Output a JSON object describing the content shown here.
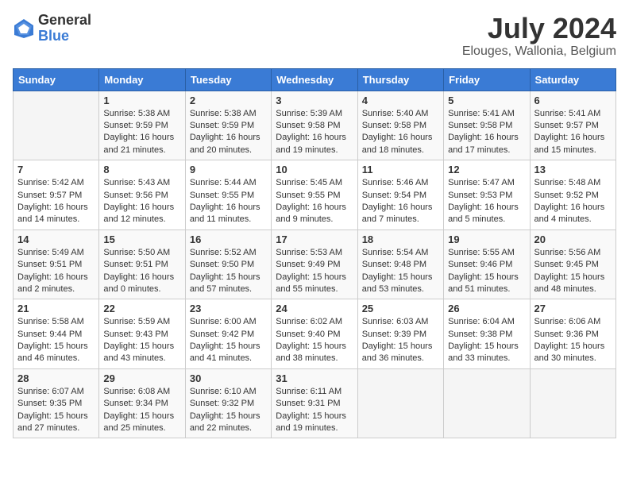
{
  "header": {
    "logo_general": "General",
    "logo_blue": "Blue",
    "main_title": "July 2024",
    "subtitle": "Elouges, Wallonia, Belgium"
  },
  "calendar": {
    "days_of_week": [
      "Sunday",
      "Monday",
      "Tuesday",
      "Wednesday",
      "Thursday",
      "Friday",
      "Saturday"
    ],
    "weeks": [
      [
        {
          "day": "",
          "sunrise": "",
          "sunset": "",
          "daylight": ""
        },
        {
          "day": "1",
          "sunrise": "Sunrise: 5:38 AM",
          "sunset": "Sunset: 9:59 PM",
          "daylight": "Daylight: 16 hours and 21 minutes."
        },
        {
          "day": "2",
          "sunrise": "Sunrise: 5:38 AM",
          "sunset": "Sunset: 9:59 PM",
          "daylight": "Daylight: 16 hours and 20 minutes."
        },
        {
          "day": "3",
          "sunrise": "Sunrise: 5:39 AM",
          "sunset": "Sunset: 9:58 PM",
          "daylight": "Daylight: 16 hours and 19 minutes."
        },
        {
          "day": "4",
          "sunrise": "Sunrise: 5:40 AM",
          "sunset": "Sunset: 9:58 PM",
          "daylight": "Daylight: 16 hours and 18 minutes."
        },
        {
          "day": "5",
          "sunrise": "Sunrise: 5:41 AM",
          "sunset": "Sunset: 9:58 PM",
          "daylight": "Daylight: 16 hours and 17 minutes."
        },
        {
          "day": "6",
          "sunrise": "Sunrise: 5:41 AM",
          "sunset": "Sunset: 9:57 PM",
          "daylight": "Daylight: 16 hours and 15 minutes."
        }
      ],
      [
        {
          "day": "7",
          "sunrise": "Sunrise: 5:42 AM",
          "sunset": "Sunset: 9:57 PM",
          "daylight": "Daylight: 16 hours and 14 minutes."
        },
        {
          "day": "8",
          "sunrise": "Sunrise: 5:43 AM",
          "sunset": "Sunset: 9:56 PM",
          "daylight": "Daylight: 16 hours and 12 minutes."
        },
        {
          "day": "9",
          "sunrise": "Sunrise: 5:44 AM",
          "sunset": "Sunset: 9:55 PM",
          "daylight": "Daylight: 16 hours and 11 minutes."
        },
        {
          "day": "10",
          "sunrise": "Sunrise: 5:45 AM",
          "sunset": "Sunset: 9:55 PM",
          "daylight": "Daylight: 16 hours and 9 minutes."
        },
        {
          "day": "11",
          "sunrise": "Sunrise: 5:46 AM",
          "sunset": "Sunset: 9:54 PM",
          "daylight": "Daylight: 16 hours and 7 minutes."
        },
        {
          "day": "12",
          "sunrise": "Sunrise: 5:47 AM",
          "sunset": "Sunset: 9:53 PM",
          "daylight": "Daylight: 16 hours and 5 minutes."
        },
        {
          "day": "13",
          "sunrise": "Sunrise: 5:48 AM",
          "sunset": "Sunset: 9:52 PM",
          "daylight": "Daylight: 16 hours and 4 minutes."
        }
      ],
      [
        {
          "day": "14",
          "sunrise": "Sunrise: 5:49 AM",
          "sunset": "Sunset: 9:51 PM",
          "daylight": "Daylight: 16 hours and 2 minutes."
        },
        {
          "day": "15",
          "sunrise": "Sunrise: 5:50 AM",
          "sunset": "Sunset: 9:51 PM",
          "daylight": "Daylight: 16 hours and 0 minutes."
        },
        {
          "day": "16",
          "sunrise": "Sunrise: 5:52 AM",
          "sunset": "Sunset: 9:50 PM",
          "daylight": "Daylight: 15 hours and 57 minutes."
        },
        {
          "day": "17",
          "sunrise": "Sunrise: 5:53 AM",
          "sunset": "Sunset: 9:49 PM",
          "daylight": "Daylight: 15 hours and 55 minutes."
        },
        {
          "day": "18",
          "sunrise": "Sunrise: 5:54 AM",
          "sunset": "Sunset: 9:48 PM",
          "daylight": "Daylight: 15 hours and 53 minutes."
        },
        {
          "day": "19",
          "sunrise": "Sunrise: 5:55 AM",
          "sunset": "Sunset: 9:46 PM",
          "daylight": "Daylight: 15 hours and 51 minutes."
        },
        {
          "day": "20",
          "sunrise": "Sunrise: 5:56 AM",
          "sunset": "Sunset: 9:45 PM",
          "daylight": "Daylight: 15 hours and 48 minutes."
        }
      ],
      [
        {
          "day": "21",
          "sunrise": "Sunrise: 5:58 AM",
          "sunset": "Sunset: 9:44 PM",
          "daylight": "Daylight: 15 hours and 46 minutes."
        },
        {
          "day": "22",
          "sunrise": "Sunrise: 5:59 AM",
          "sunset": "Sunset: 9:43 PM",
          "daylight": "Daylight: 15 hours and 43 minutes."
        },
        {
          "day": "23",
          "sunrise": "Sunrise: 6:00 AM",
          "sunset": "Sunset: 9:42 PM",
          "daylight": "Daylight: 15 hours and 41 minutes."
        },
        {
          "day": "24",
          "sunrise": "Sunrise: 6:02 AM",
          "sunset": "Sunset: 9:40 PM",
          "daylight": "Daylight: 15 hours and 38 minutes."
        },
        {
          "day": "25",
          "sunrise": "Sunrise: 6:03 AM",
          "sunset": "Sunset: 9:39 PM",
          "daylight": "Daylight: 15 hours and 36 minutes."
        },
        {
          "day": "26",
          "sunrise": "Sunrise: 6:04 AM",
          "sunset": "Sunset: 9:38 PM",
          "daylight": "Daylight: 15 hours and 33 minutes."
        },
        {
          "day": "27",
          "sunrise": "Sunrise: 6:06 AM",
          "sunset": "Sunset: 9:36 PM",
          "daylight": "Daylight: 15 hours and 30 minutes."
        }
      ],
      [
        {
          "day": "28",
          "sunrise": "Sunrise: 6:07 AM",
          "sunset": "Sunset: 9:35 PM",
          "daylight": "Daylight: 15 hours and 27 minutes."
        },
        {
          "day": "29",
          "sunrise": "Sunrise: 6:08 AM",
          "sunset": "Sunset: 9:34 PM",
          "daylight": "Daylight: 15 hours and 25 minutes."
        },
        {
          "day": "30",
          "sunrise": "Sunrise: 6:10 AM",
          "sunset": "Sunset: 9:32 PM",
          "daylight": "Daylight: 15 hours and 22 minutes."
        },
        {
          "day": "31",
          "sunrise": "Sunrise: 6:11 AM",
          "sunset": "Sunset: 9:31 PM",
          "daylight": "Daylight: 15 hours and 19 minutes."
        },
        {
          "day": "",
          "sunrise": "",
          "sunset": "",
          "daylight": ""
        },
        {
          "day": "",
          "sunrise": "",
          "sunset": "",
          "daylight": ""
        },
        {
          "day": "",
          "sunrise": "",
          "sunset": "",
          "daylight": ""
        }
      ]
    ]
  }
}
